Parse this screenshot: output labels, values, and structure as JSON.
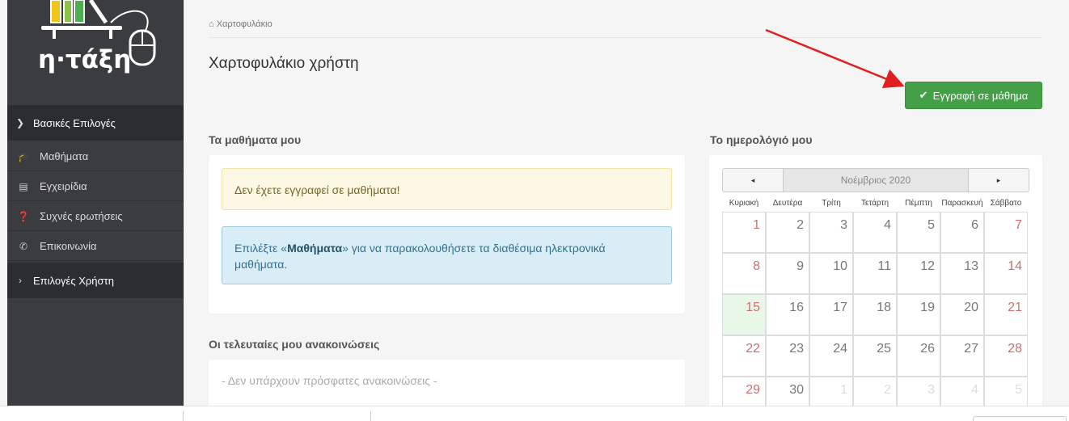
{
  "logo": {
    "text": "η·τάξη"
  },
  "sidebar": {
    "groups": [
      {
        "label": "Βασικές Επιλογές",
        "icon": "chevron-down-icon"
      },
      {
        "label": "Επιλογές Χρήστη",
        "icon": "chevron-right-icon"
      }
    ],
    "items": [
      {
        "label": "Μαθήματα",
        "icon": "graduation-cap-icon"
      },
      {
        "label": "Εγχειρίδια",
        "icon": "document-icon"
      },
      {
        "label": "Συχνές ερωτήσεις",
        "icon": "question-circle-icon"
      },
      {
        "label": "Επικοινωνία",
        "icon": "phone-icon"
      }
    ]
  },
  "breadcrumb": {
    "icon": "home-icon",
    "label": "Χαρτοφυλάκιο"
  },
  "page": {
    "title": "Χαρτοφυλάκιο χρήστη",
    "enroll_button": "Εγγραφή σε μάθημα"
  },
  "courses": {
    "title": "Τα μαθήματα μου",
    "warning": "Δεν έχετε εγγραφεί σε μαθήματα!",
    "info_prefix": "Επιλέξτε «",
    "info_link": "Μαθήματα",
    "info_suffix": "» για να παρακολουθήσετε τα διαθέσιμα ηλεκτρονικά μαθήματα."
  },
  "announcements": {
    "title": "Οι τελευταίες μου ανακοινώσεις",
    "empty": "- Δεν υπάρχουν πρόσφατες ανακοινώσεις -"
  },
  "calendar": {
    "title": "Το ημερολόγιό μου",
    "month": "Νοέμβριος 2020",
    "prev": "◂",
    "next": "▸",
    "weekdays": [
      "Κυριακή",
      "Δευτέρα",
      "Τρίτη",
      "Τετάρτη",
      "Πέμπτη",
      "Παρασκευή",
      "Σάββατο"
    ],
    "today": "15",
    "weeks": [
      [
        "1",
        "2",
        "3",
        "4",
        "5",
        "6",
        "7"
      ],
      [
        "8",
        "9",
        "10",
        "11",
        "12",
        "13",
        "14"
      ],
      [
        "15",
        "16",
        "17",
        "18",
        "19",
        "20",
        "21"
      ],
      [
        "22",
        "23",
        "24",
        "25",
        "26",
        "27",
        "28"
      ],
      [
        "29",
        "30",
        "1",
        "2",
        "3",
        "4",
        "5"
      ]
    ]
  },
  "colors": {
    "sidebar": "#3a3c40",
    "primary_button": "#43a047",
    "arrow": "#e02020"
  }
}
